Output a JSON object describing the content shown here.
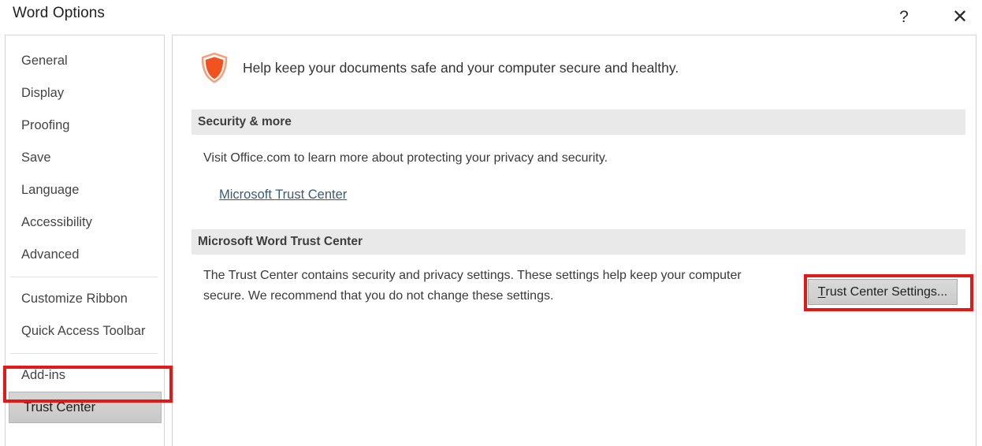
{
  "window": {
    "title": "Word Options",
    "help_label": "?",
    "close_label": "✕"
  },
  "sidebar": {
    "groups": [
      {
        "items": [
          {
            "label": "General",
            "selected": false
          },
          {
            "label": "Display",
            "selected": false
          },
          {
            "label": "Proofing",
            "selected": false
          },
          {
            "label": "Save",
            "selected": false
          },
          {
            "label": "Language",
            "selected": false
          },
          {
            "label": "Accessibility",
            "selected": false
          },
          {
            "label": "Advanced",
            "selected": false
          }
        ]
      },
      {
        "items": [
          {
            "label": "Customize Ribbon",
            "selected": false
          },
          {
            "label": "Quick Access Toolbar",
            "selected": false
          }
        ]
      },
      {
        "items": [
          {
            "label": "Add-ins",
            "selected": false
          },
          {
            "label": "Trust Center",
            "selected": true
          }
        ]
      }
    ]
  },
  "content": {
    "header": {
      "icon": "shield-icon",
      "text": "Help keep your documents safe and your computer secure and healthy."
    },
    "sections": [
      {
        "title": "Security & more",
        "description": "Visit Office.com to learn more about protecting your privacy and security.",
        "link_label": "Microsoft Trust Center"
      },
      {
        "title": "Microsoft Word Trust Center",
        "paragraph": "The Trust Center contains security and privacy settings. These settings help keep your computer secure. We recommend that you do not change these settings.",
        "button": {
          "accel": "T",
          "rest": "rust Center Settings..."
        }
      }
    ]
  },
  "colors": {
    "shield_fill": "#F0531F",
    "shield_outline": "#F4A07F",
    "highlight_red": "#E11919",
    "selected_nav_bg": "#D0D0D0",
    "section_bar_bg": "#E9E9E9",
    "link": "#3B5A74"
  }
}
